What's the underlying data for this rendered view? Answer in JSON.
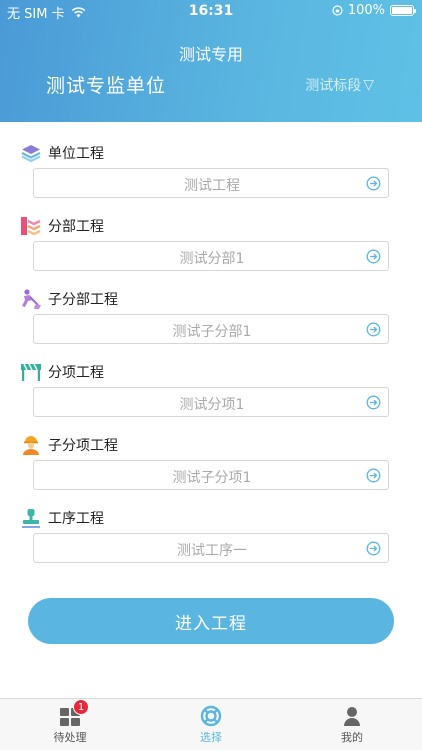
{
  "status_bar": {
    "carrier": "无 SIM 卡",
    "time": "16:31",
    "battery": "100%",
    "battery_level": 1.0
  },
  "header": {
    "title": "测试专用",
    "unit_name": "测试专监单位",
    "section_select": "测试标段",
    "section_arrow": "▽"
  },
  "fields": [
    {
      "label": "单位工程",
      "value": "测试工程",
      "icon": "layers-icon"
    },
    {
      "label": "分部工程",
      "value": "测试分部1",
      "icon": "chevron-stack-icon"
    },
    {
      "label": "子分部工程",
      "value": "测试子分部1",
      "icon": "worker-digging-icon"
    },
    {
      "label": "分项工程",
      "value": "测试分项1",
      "icon": "barrier-icon"
    },
    {
      "label": "子分项工程",
      "value": "测试子分项1",
      "icon": "construction-worker-icon"
    },
    {
      "label": "工序工程",
      "value": "测试工序一",
      "icon": "stamp-icon"
    }
  ],
  "enter_button": "进入工程",
  "tabs": [
    {
      "label": "待处理",
      "icon": "grid-icon",
      "badge": "1"
    },
    {
      "label": "选择",
      "icon": "lifebuoy-icon",
      "active": true
    },
    {
      "label": "我的",
      "icon": "user-icon"
    }
  ],
  "colors": {
    "accent": "#5ab6e0",
    "header_start": "#4a9ad6",
    "badge": "#e8283a"
  }
}
